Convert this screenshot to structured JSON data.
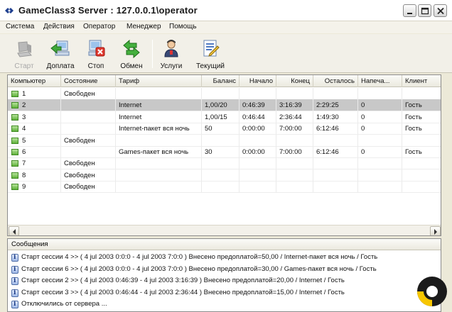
{
  "window": {
    "title": "GameClass3 Server : 127.0.0.1\\operator"
  },
  "menu": [
    "Система",
    "Действия",
    "Оператор",
    "Менеджер",
    "Помощь"
  ],
  "toolbar": [
    {
      "label": "Старт",
      "icon": "computer-start-icon",
      "disabled": true
    },
    {
      "label": "Доплата",
      "icon": "add-payment-icon",
      "disabled": false
    },
    {
      "label": "Стоп",
      "icon": "stop-computer-icon",
      "disabled": false
    },
    {
      "label": "Обмен",
      "icon": "exchange-arrows-icon",
      "disabled": false
    },
    {
      "label": "Услуги",
      "icon": "services-person-icon",
      "disabled": false
    },
    {
      "label": "Текущий",
      "icon": "current-report-icon",
      "disabled": false
    }
  ],
  "table": {
    "columns": [
      "Компьютер",
      "Состояние",
      "Тариф",
      "Баланс",
      "Начало",
      "Конец",
      "Осталось",
      "Напеча...",
      "Клиент"
    ],
    "rows": [
      {
        "computer": "1",
        "state": "Свободен",
        "tariff": "",
        "balance": "",
        "start": "",
        "end": "",
        "left": "",
        "printed": "",
        "client": ""
      },
      {
        "computer": "2",
        "state": "",
        "tariff": "Internet",
        "balance": "1,00/20",
        "start": "0:46:39",
        "end": "3:16:39",
        "left": "2:29:25",
        "printed": "0",
        "client": "Гость",
        "selected": true
      },
      {
        "computer": "3",
        "state": "",
        "tariff": "Internet",
        "balance": "1,00/15",
        "start": "0:46:44",
        "end": "2:36:44",
        "left": "1:49:30",
        "printed": "0",
        "client": "Гость"
      },
      {
        "computer": "4",
        "state": "",
        "tariff": "Internet-пакет вся ночь",
        "balance": "50",
        "start": "0:00:00",
        "end": "7:00:00",
        "left": "6:12:46",
        "printed": "0",
        "client": "Гость"
      },
      {
        "computer": "5",
        "state": "Свободен",
        "tariff": "",
        "balance": "",
        "start": "",
        "end": "",
        "left": "",
        "printed": "",
        "client": ""
      },
      {
        "computer": "6",
        "state": "",
        "tariff": "Games-пакет вся ночь",
        "balance": "30",
        "start": "0:00:00",
        "end": "7:00:00",
        "left": "6:12:46",
        "printed": "0",
        "client": "Гость"
      },
      {
        "computer": "7",
        "state": "Свободен",
        "tariff": "",
        "balance": "",
        "start": "",
        "end": "",
        "left": "",
        "printed": "",
        "client": ""
      },
      {
        "computer": "8",
        "state": "Свободен",
        "tariff": "",
        "balance": "",
        "start": "",
        "end": "",
        "left": "",
        "printed": "",
        "client": ""
      },
      {
        "computer": "9",
        "state": "Свободен",
        "tariff": "",
        "balance": "",
        "start": "",
        "end": "",
        "left": "",
        "printed": "",
        "client": ""
      }
    ]
  },
  "messages": {
    "header": "Сообщения",
    "items": [
      "Старт сессии 4 >> ( 4 jul 2003 0:0:0 - 4 jul 2003 7:0:0 ) Внесено предоплатой=50,00 / Internet-пакет вся ночь / Гость",
      "Старт сессии 6 >> ( 4 jul 2003 0:0:0 - 4 jul 2003 7:0:0 ) Внесено предоплатой=30,00 / Games-пакет вся ночь / Гость",
      "Старт сессии 2 >> ( 4 jul 2003 0:46:39 - 4 jul 2003 3:16:39 ) Внесено предоплатой=20,00 / Internet / Гость",
      "Старт сессии 3 >> ( 4 jul 2003 0:46:44 - 4 jul 2003 2:36:44 ) Внесено предоплатой=15,00 / Internet / Гость",
      "Отключились от сервера ..."
    ]
  },
  "colors": {
    "selected_row": "#c8c8c8",
    "computer_icon": "#5fb13a",
    "logo_yellow": "#f7c600",
    "logo_dark": "#1b1b1b"
  }
}
